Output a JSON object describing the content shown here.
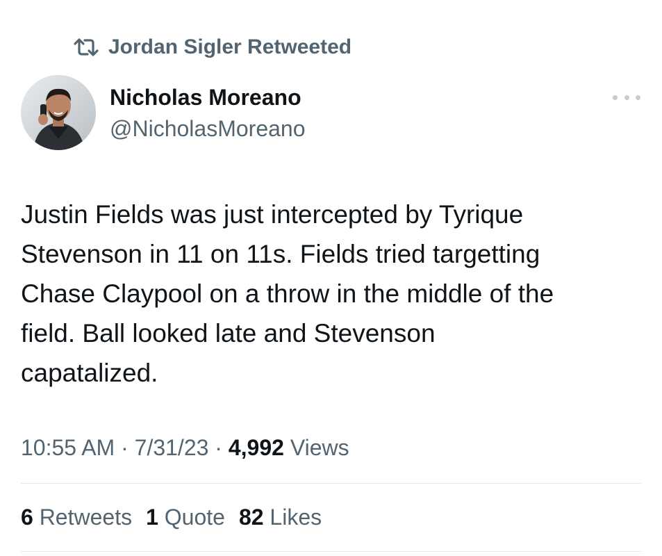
{
  "retweet_context": {
    "text": "Jordan Sigler Retweeted",
    "icon": "retweet-icon"
  },
  "author": {
    "name": "Nicholas Moreano",
    "handle": "@NicholasMoreano",
    "avatar": "avatar-photo"
  },
  "more_icon": "more-horizontal-icon",
  "tweet": {
    "text": "Justin Fields was just intercepted by Tyrique\nStevenson in 11 on 11s. Fields tried targetting\nChase Claypool on a throw in the middle of the\nfield. Ball looked late and Stevenson\ncapatalized."
  },
  "meta": {
    "time": "10:55 AM",
    "sep1": " · ",
    "date": "7/31/23",
    "sep2": " · ",
    "views_count": "4,992",
    "views_label": "Views"
  },
  "stats": {
    "retweets_count": "6",
    "retweets_label": "Retweets",
    "quotes_count": "1",
    "quotes_label": "Quote",
    "likes_count": "82",
    "likes_label": "Likes"
  },
  "colors": {
    "primary_text": "#0f1419",
    "secondary_text": "#536471",
    "divider": "#e4e8eb"
  }
}
